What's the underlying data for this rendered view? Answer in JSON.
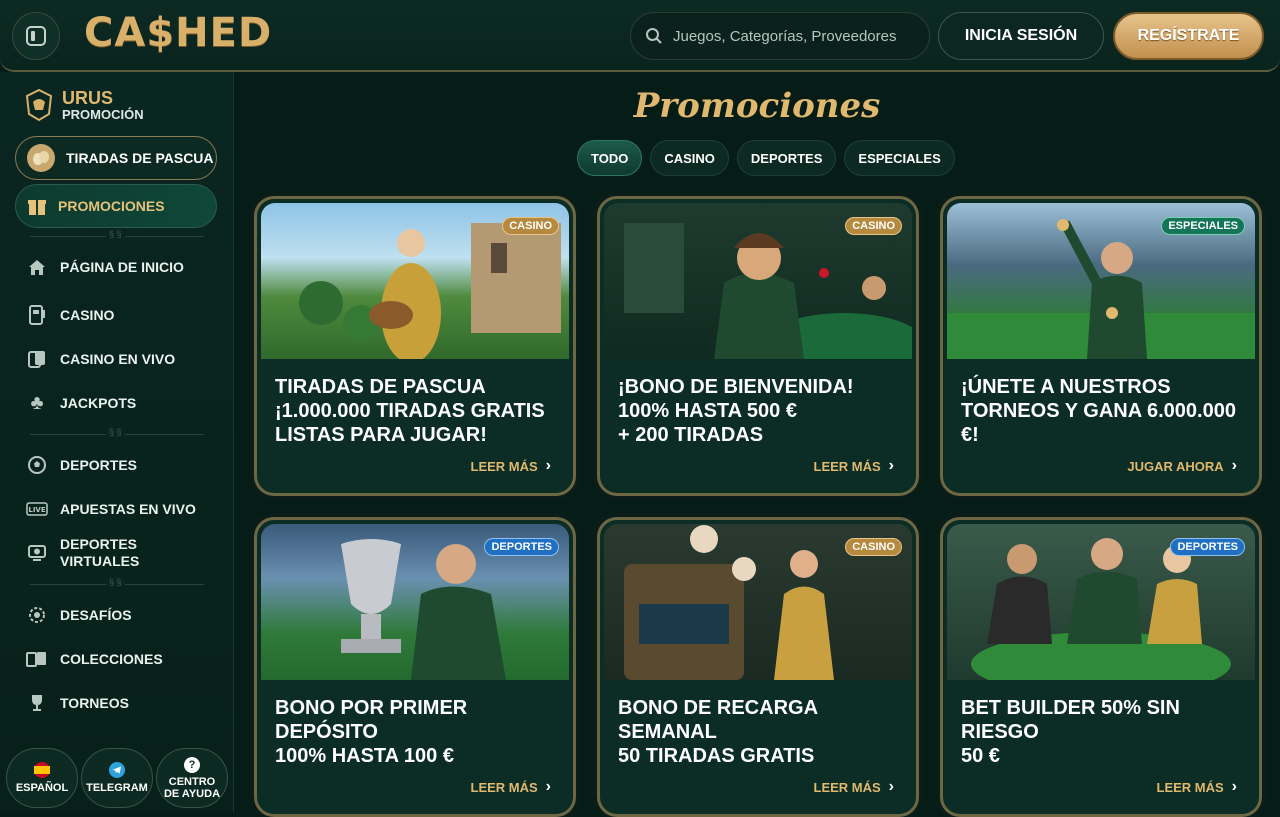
{
  "header": {
    "logo": "CA$HED",
    "search_placeholder": "Juegos, Categorías, Proveedores",
    "login_label": "INICIA SESIÓN",
    "register_label": "REGÍSTRATE"
  },
  "sidebar": {
    "urus_title": "URUS",
    "urus_sub": "PROMOCIÓN",
    "easter_label": "TIRADAS DE PASCUA",
    "promo_label": "PROMOCIONES",
    "items": [
      {
        "label": "PÁGINA DE INICIO",
        "icon": "home-icon"
      },
      {
        "label": "CASINO",
        "icon": "slot-machine-icon"
      },
      {
        "label": "CASINO EN VIVO",
        "icon": "cards-icon"
      },
      {
        "label": "JACKPOTS",
        "icon": "clover-icon"
      },
      {
        "label": "DEPORTES",
        "icon": "soccer-ball-icon"
      },
      {
        "label": "APUESTAS EN VIVO",
        "icon": "live-icon"
      },
      {
        "label": "DEPORTES",
        "label2": "VIRTUALES",
        "icon": "virtual-sports-icon"
      },
      {
        "label": "DESAFÍOS",
        "icon": "challenge-icon"
      },
      {
        "label": "COLECCIONES",
        "icon": "collection-icon"
      },
      {
        "label": "TORNEOS",
        "icon": "trophy-icon"
      }
    ],
    "bottom": {
      "lang": "ESPAÑOL",
      "telegram": "TELEGRAM",
      "help_1": "CENTRO",
      "help_2": "DE AYUDA"
    }
  },
  "main": {
    "title": "Promociones",
    "tabs": [
      "TODO",
      "CASINO",
      "DEPORTES",
      "ESPECIALES"
    ],
    "active_tab": "TODO",
    "cards": [
      {
        "badge": "CASINO",
        "lines": [
          "TIRADAS DE PASCUA",
          "¡1.000.000 TIRADAS GRATIS",
          "LISTAS PARA JUGAR!"
        ],
        "link": "LEER MÁS"
      },
      {
        "badge": "CASINO",
        "lines": [
          "¡BONO DE BIENVENIDA!",
          "100% HASTA 500 €",
          "+ 200 TIRADAS"
        ],
        "link": "LEER MÁS"
      },
      {
        "badge": "ESPECIALES",
        "lines": [
          "¡ÚNETE A NUESTROS",
          "TORNEOS Y GANA 6.000.000",
          "€!"
        ],
        "link": "JUGAR AHORA"
      },
      {
        "badge": "DEPORTES",
        "lines": [
          "BONO POR PRIMER DEPÓSITO",
          "100% HASTA 100 €",
          ""
        ],
        "link": "LEER MÁS"
      },
      {
        "badge": "CASINO",
        "lines": [
          "BONO DE RECARGA",
          "SEMANAL",
          "50 TIRADAS GRATIS"
        ],
        "link": "LEER MÁS"
      },
      {
        "badge": "DEPORTES",
        "lines": [
          "BET BUILDER 50% SIN RIESGO",
          "50 €",
          ""
        ],
        "link": "LEER MÁS"
      }
    ]
  },
  "colors": {
    "gold": "#e0b86e",
    "bg": "#061c17",
    "card": "#0b2d25",
    "sport_badge": "#1f6fc3",
    "casino_badge": "#b58a3e"
  }
}
